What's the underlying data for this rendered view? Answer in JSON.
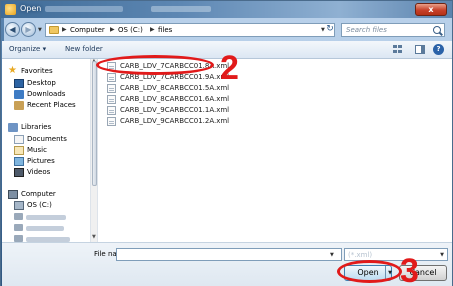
{
  "window": {
    "title": "Open",
    "close_glyph": "x"
  },
  "address": {
    "crumbs": [
      "Computer",
      "OS (C:)",
      "files"
    ],
    "search_placeholder": "Search files"
  },
  "toolbar": {
    "organize_label": "Organize ▾",
    "new_folder_label": "New folder"
  },
  "nav": {
    "favorites": "Favorites",
    "desktop": "Desktop",
    "downloads": "Downloads",
    "recent": "Recent Places",
    "libraries": "Libraries",
    "documents": "Documents",
    "music": "Music",
    "pictures": "Pictures",
    "videos": "Videos",
    "computer": "Computer",
    "os_c": "OS (C:)"
  },
  "files": [
    "CARB_LDV_7CARBCC01.8A.xml",
    "CARB_LDV_7CARBCC01.9A.xml",
    "CARB_LDV_8CARBCC01.5A.xml",
    "CARB_LDV_8CARBCC01.6A.xml",
    "CARB_LDV_9CARBCC01.1A.xml",
    "CARB_LDV_9CARBCC01.2A.xml"
  ],
  "bottom": {
    "file_name_label": "File name:",
    "file_name_value": "",
    "file_type_value": "(*.xml)",
    "open_label": "Open",
    "cancel_label": "Cancel"
  },
  "annotations": {
    "step2": "2",
    "step3": "3",
    "color": "#e11a1a"
  }
}
